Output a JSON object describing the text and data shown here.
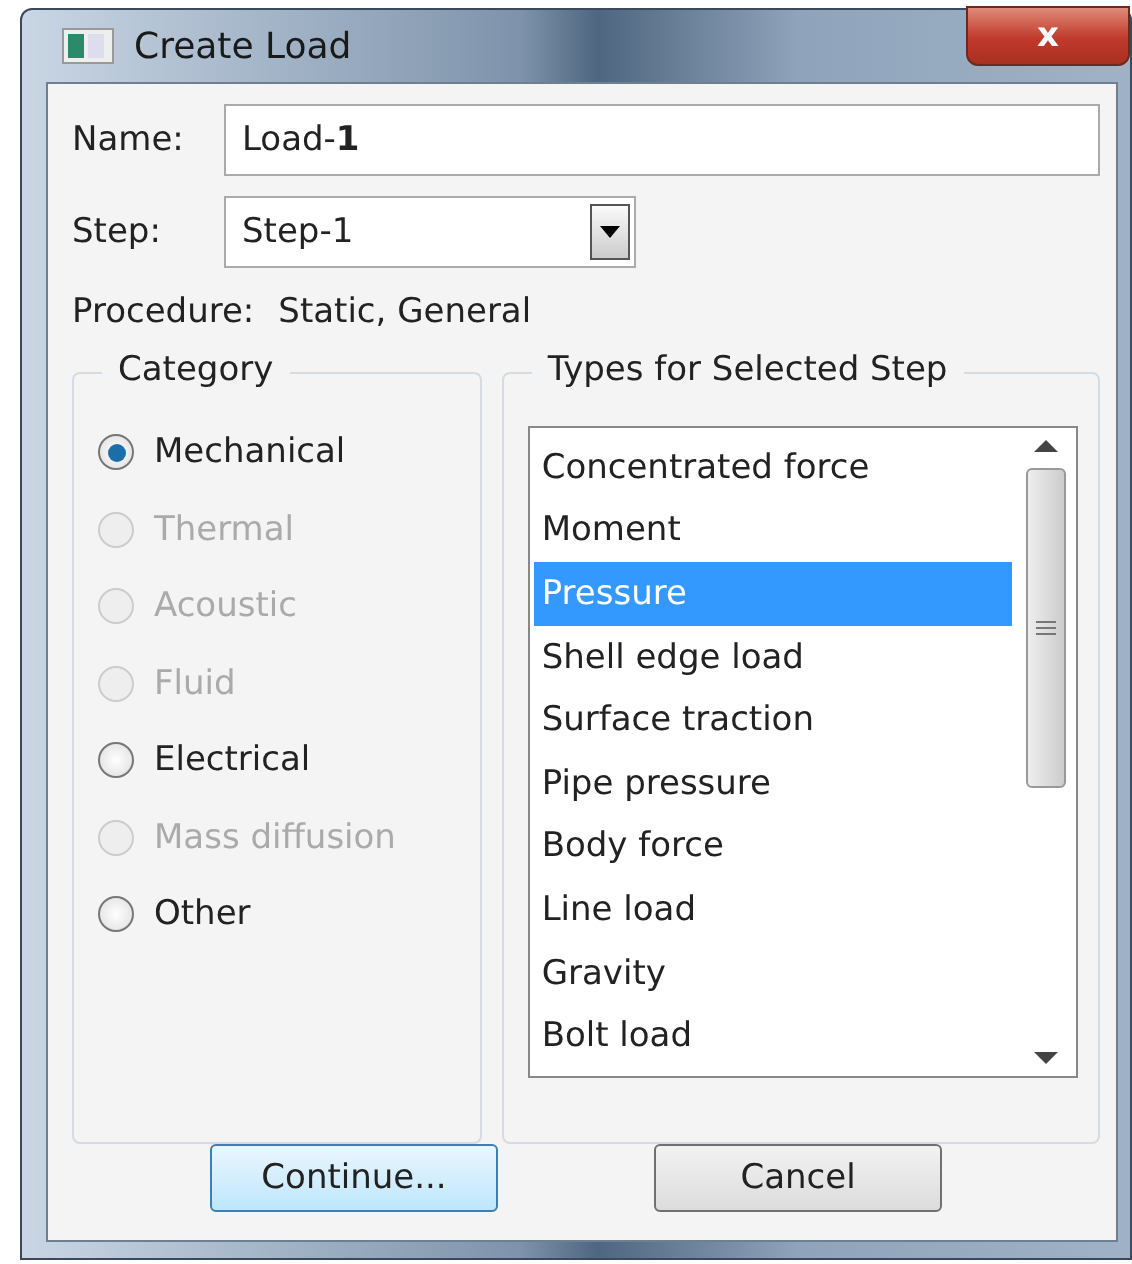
{
  "window": {
    "title": "Create Load",
    "close": "x"
  },
  "name": {
    "label": "Name:",
    "value": "Load-**1**"
  },
  "step": {
    "label": "Step:",
    "value": "Step-1"
  },
  "procedure": {
    "label": "Procedure:",
    "value": "Static, General"
  },
  "category": {
    "title": "Category",
    "options": [
      {
        "label": "Mechanical",
        "selected": true,
        "disabled": false
      },
      {
        "label": "Thermal",
        "selected": false,
        "disabled": true
      },
      {
        "label": "Acoustic",
        "selected": false,
        "disabled": true
      },
      {
        "label": "Fluid",
        "selected": false,
        "disabled": true
      },
      {
        "label": "Electrical",
        "selected": false,
        "disabled": false
      },
      {
        "label": "Mass diffusion",
        "selected": false,
        "disabled": true
      },
      {
        "label": "Other",
        "selected": false,
        "disabled": false
      }
    ]
  },
  "types": {
    "title": "Types for Selected Step",
    "items": [
      {
        "label": "Concentrated force",
        "selected": false
      },
      {
        "label": "Moment",
        "selected": false
      },
      {
        "label": "Pressure",
        "selected": true
      },
      {
        "label": "Shell edge load",
        "selected": false
      },
      {
        "label": "Surface traction",
        "selected": false
      },
      {
        "label": "Pipe pressure",
        "selected": false
      },
      {
        "label": "Body force",
        "selected": false
      },
      {
        "label": "Line load",
        "selected": false
      },
      {
        "label": "Gravity",
        "selected": false
      },
      {
        "label": "Bolt load",
        "selected": false
      }
    ]
  },
  "buttons": [
    {
      "label": "Continue...",
      "default": true
    },
    {
      "label": "Cancel",
      "default": false
    }
  ]
}
